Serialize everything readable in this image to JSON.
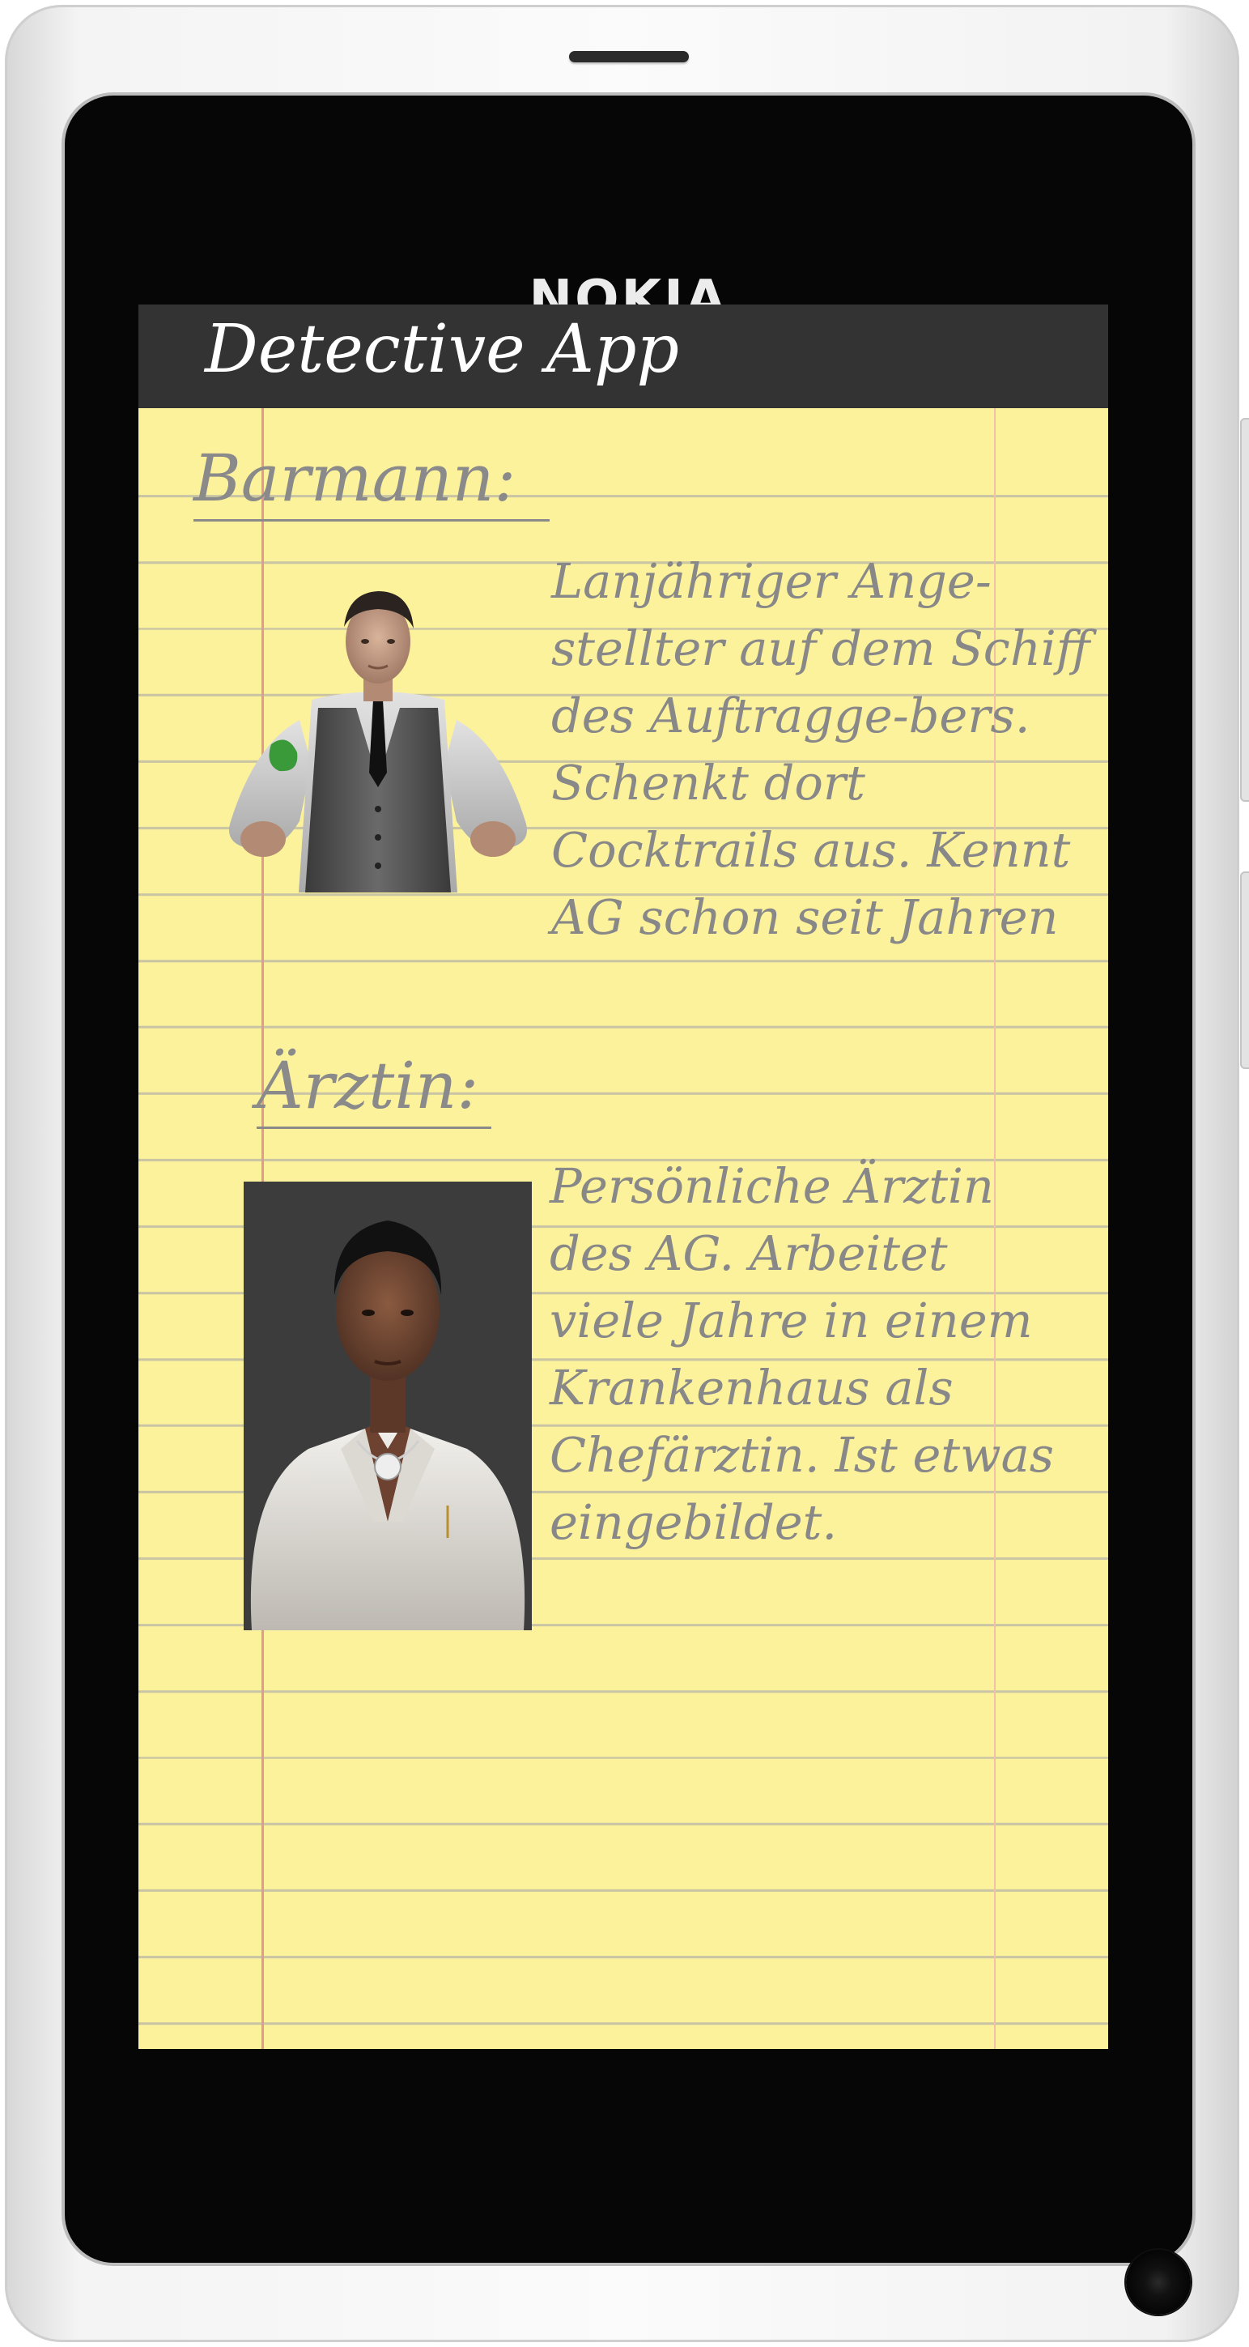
{
  "device": {
    "brand": "NOKIA"
  },
  "app": {
    "title": "Detective App"
  },
  "characters": [
    {
      "heading": "Barmann:",
      "description": "Lanjähriger Ange-stellter auf dem Schiff des Auftragge-bers. Schenkt dort Cocktrails aus. Kennt AG schon seit Jahren"
    },
    {
      "heading": "Ärztin:",
      "description": "Persönliche Ärztin des AG. Arbeitet viele Jahre in einem Krankenhaus als Chefärztin. Ist etwas eingebildet."
    }
  ],
  "colors": {
    "paper": "#fdf29c",
    "title_bar": "#333333",
    "ink": "#8a8a8a",
    "margin_line": "#e49a8d"
  }
}
